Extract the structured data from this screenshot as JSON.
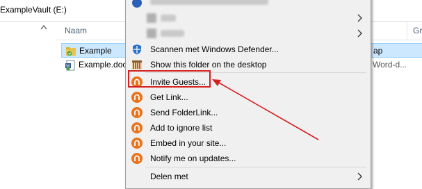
{
  "explorer": {
    "path_title": "ExampleVault (E:)",
    "column_name": "Naam",
    "column_group_partial": "Gr",
    "files": [
      {
        "name": "Example",
        "type_partial": "ap",
        "selected": true,
        "icon": "folder-icon"
      },
      {
        "name": "Example.doc",
        "type_partial": "Word-d...",
        "selected": false,
        "icon": "word-doc-icon"
      }
    ]
  },
  "context_menu": {
    "top_partial_label": "Scannen met Windows Defender top item (partial)",
    "items": [
      {
        "label": "Scannen met Windows Defender...",
        "icon": "windows-defender-icon"
      },
      {
        "label": "Show this folder on the desktop",
        "icon": "show-on-desktop-icon"
      },
      {
        "label": "Invite Guests...",
        "icon": "m-app-icon"
      },
      {
        "label": "Get Link...",
        "icon": "m-app-icon"
      },
      {
        "label": "Send FolderLink...",
        "icon": "m-app-icon"
      },
      {
        "label": "Add to ignore list",
        "icon": "m-app-icon"
      },
      {
        "label": "Embed in your site...",
        "icon": "m-app-icon"
      },
      {
        "label": "Notify me on updates...",
        "icon": "m-app-icon"
      },
      {
        "label": "Delen met",
        "icon": ""
      }
    ]
  },
  "colors": {
    "accent_orange": "#e8731a",
    "annotation_red": "#d62020",
    "selection_blue": "#cce8ff"
  }
}
